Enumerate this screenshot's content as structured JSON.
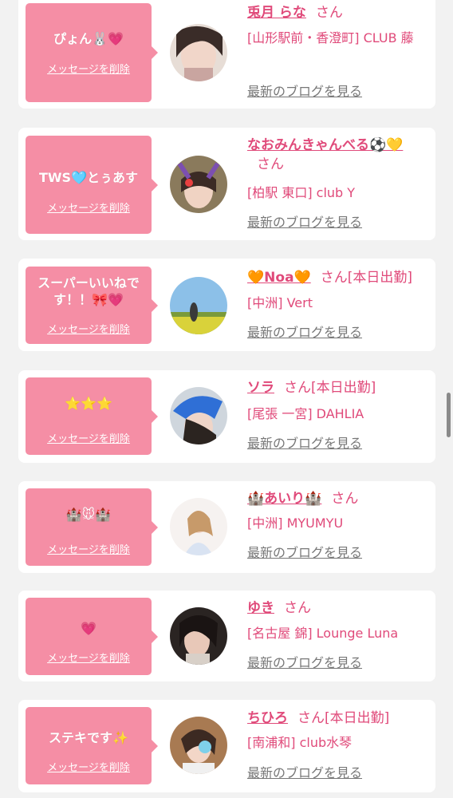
{
  "delete_label": "メッセージを削除",
  "blog_label": "最新のブログを見る",
  "san": "さん",
  "cards": [
    {
      "message": "ぴょん🐰💗",
      "name": "兎月 らな",
      "status": "",
      "shop": "[山形駅前・香澄町] CLUB 藤"
    },
    {
      "message": "TWS🩵とぅあす",
      "name": "なおみんきゃんべる⚽💛",
      "status": "",
      "shop": "[柏駅 東口] club Y"
    },
    {
      "message": "スーパーいいねです！！🎀💗",
      "name": "🧡Noa🧡",
      "status": "[本日出勤]",
      "shop": "[中洲] Vert"
    },
    {
      "message": "⭐⭐⭐",
      "name": "ソラ",
      "status": "[本日出勤]",
      "shop": "[尾張 一宮] DAHLIA"
    },
    {
      "message": "🏰🐭🏰",
      "name": "🏰あいり🏰",
      "status": "",
      "shop": "[中洲] MYUMYU"
    },
    {
      "message": "💗",
      "name": "ゆき",
      "status": "",
      "shop": "[名古屋 錦] Lounge Luna"
    },
    {
      "message": "ステキです✨",
      "name": "ちひろ",
      "status": "[本日出勤]",
      "shop": "[南浦和] club水琴"
    }
  ]
}
